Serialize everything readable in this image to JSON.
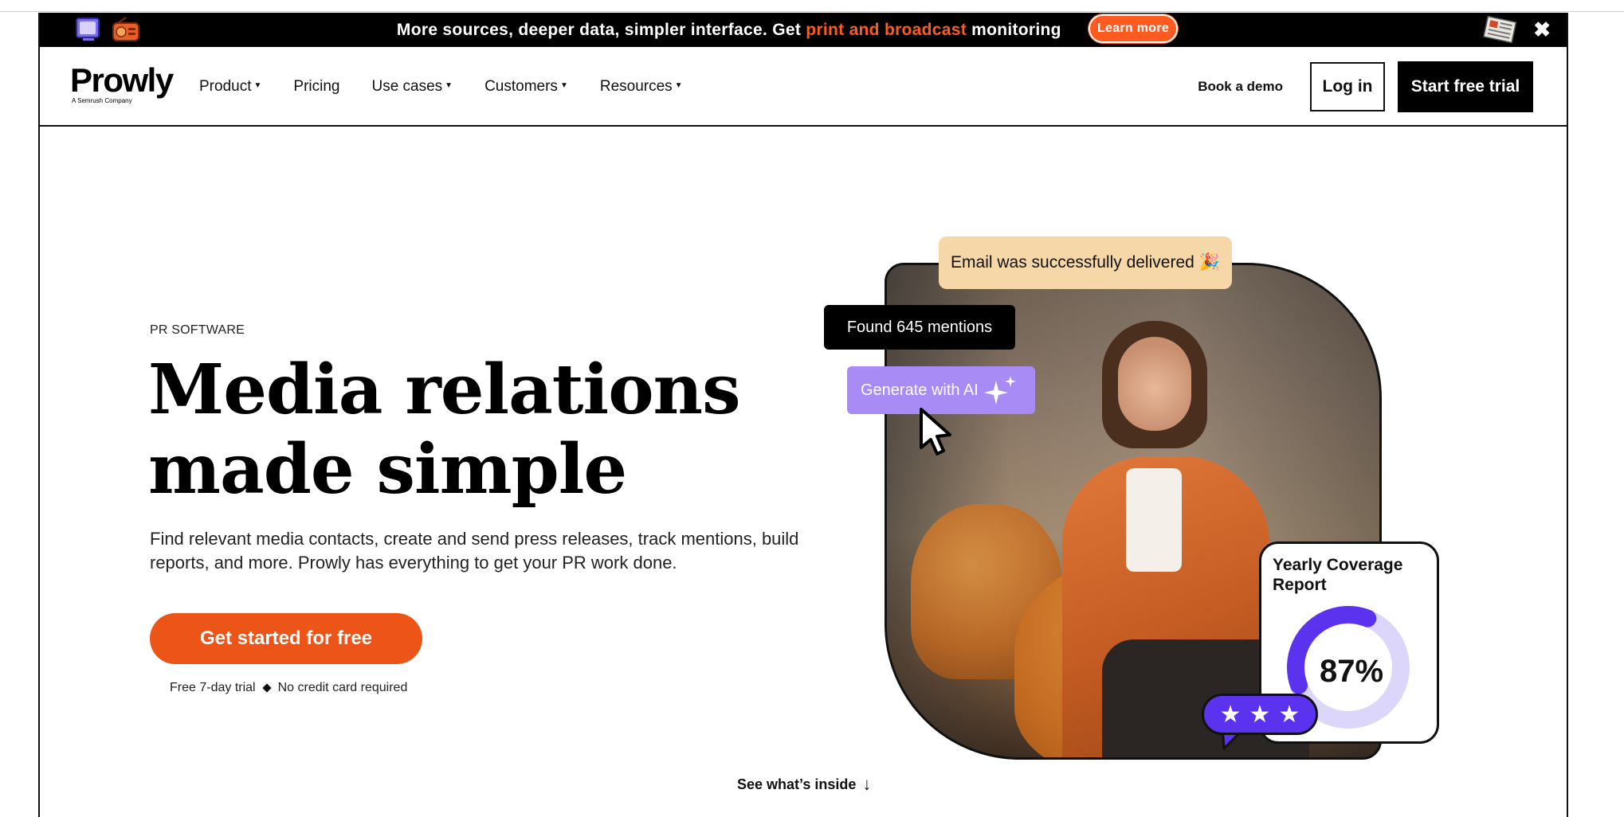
{
  "announcement": {
    "text_before": "More sources, deeper data, simpler interface. Get ",
    "highlight": "print and broadcast",
    "text_after": " monitoring",
    "learn_more": "Learn more",
    "close": "✖"
  },
  "nav": {
    "logo": "Prowly",
    "logo_sub": "A Semrush Company",
    "items": [
      {
        "label": "Product",
        "caret": true
      },
      {
        "label": "Pricing",
        "caret": false
      },
      {
        "label": "Use cases",
        "caret": true
      },
      {
        "label": "Customers",
        "caret": true
      },
      {
        "label": "Resources",
        "caret": true
      }
    ],
    "book_demo": "Book a demo",
    "login": "Log in",
    "start_trial": "Start free trial"
  },
  "hero": {
    "eyebrow": "PR SOFTWARE",
    "headline_line1": "Media relations",
    "headline_line2": "made simple",
    "subtext": "Find relevant media contacts, create and send press releases, track mentions, build reports, and more. Prowly has everything to get your PR work done.",
    "cta": "Get started for free",
    "fine_1": "Free 7-day trial",
    "fine_2": "No credit card required",
    "see_inside": "See what’s inside",
    "see_inside_arrow": "↓"
  },
  "visual": {
    "email_pill": "Email was successfully delivered",
    "email_emoji": "🎉",
    "found_pill": "Found 645 mentions",
    "ai_pill": "Generate with AI",
    "report_title": "Yearly Coverage Report",
    "report_value": "87%",
    "report_fraction": 0.87,
    "stars": [
      "★",
      "★",
      "★"
    ]
  },
  "colors": {
    "accent_orange": "#ec5418",
    "announce_orange": "#ff5a1f",
    "purple": "#5b32ee",
    "lavender": "#a98bf5",
    "email_bg": "#f6d7a8"
  },
  "icons": [
    "tv-icon",
    "radio-icon",
    "newspaper-icon",
    "close-icon",
    "sparkle-icon",
    "cursor-icon",
    "star-icon",
    "arrow-down-icon"
  ]
}
